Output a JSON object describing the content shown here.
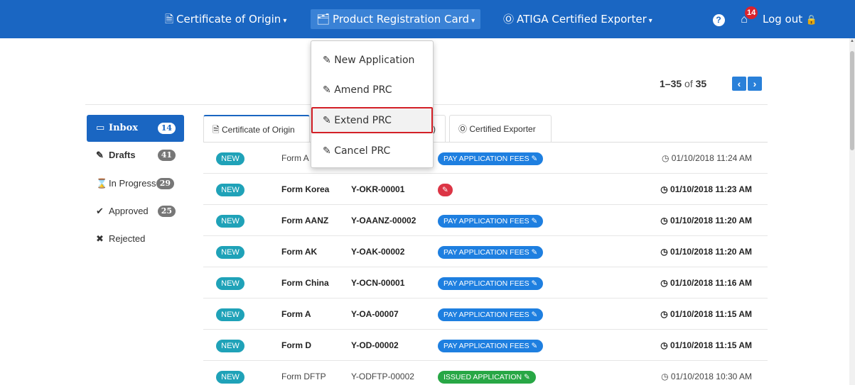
{
  "colors": {
    "navbar": "#1a66c2",
    "accent": "#2980d9",
    "badge_new": "#1fa2b8",
    "status_pay": "#1e7fe0",
    "status_issued": "#28a745",
    "status_alert": "#dc3545",
    "highlight": "#d32027"
  },
  "nav": {
    "coo": {
      "icon": "certificate-icon",
      "label": "Certificate of Origin"
    },
    "prc": {
      "icon": "card-icon",
      "label": "Product Registration Card"
    },
    "atiga": {
      "icon": "exporter-icon",
      "label": "ATIGA Certified Exporter"
    },
    "help_icon": "question-circle-icon",
    "home_icon": "home-icon",
    "notification_count": "14",
    "logout_label": "Log out",
    "logout_icon": "lock-icon"
  },
  "dropdown": {
    "items": [
      {
        "label": "New Application",
        "icon": "pencil-icon"
      },
      {
        "label": "Amend PRC",
        "icon": "pencil-icon"
      },
      {
        "label": "Extend PRC",
        "icon": "pencil-icon"
      },
      {
        "label": "Cancel PRC",
        "icon": "pencil-icon"
      }
    ]
  },
  "pagination": {
    "range": "1–35",
    "of": "of",
    "total": "35"
  },
  "sidebar": {
    "items": [
      {
        "label": "Inbox",
        "icon": "inbox-icon",
        "count": "14"
      },
      {
        "label": "Drafts",
        "icon": "edit-icon",
        "count": "41"
      },
      {
        "label": "In Progress",
        "icon": "hourglass-icon",
        "count": "29"
      },
      {
        "label": "Approved",
        "icon": "check-circle-icon",
        "count": "25"
      },
      {
        "label": "Rejected",
        "icon": "times-circle-icon",
        "count": ""
      }
    ]
  },
  "tabs": [
    {
      "label": "Certificate of Origin",
      "icon": "certificate-icon"
    },
    {
      "label": ")",
      "icon": ""
    },
    {
      "label": "Certified Exporter",
      "icon": "exporter-icon"
    }
  ],
  "rows": [
    {
      "badge": "NEW",
      "form": "Form A",
      "ref": "",
      "status": "PAY APPLICATION FEES",
      "status_type": "pay",
      "time": "01/10/2018 11:24 AM",
      "bold": false
    },
    {
      "badge": "NEW",
      "form": "Form Korea",
      "ref": "Y-OKR-00001",
      "status": "",
      "status_type": "alert",
      "time": "01/10/2018 11:23 AM",
      "bold": true
    },
    {
      "badge": "NEW",
      "form": "Form AANZ",
      "ref": "Y-OAANZ-00002",
      "status": "PAY APPLICATION FEES",
      "status_type": "pay",
      "time": "01/10/2018 11:20 AM",
      "bold": true
    },
    {
      "badge": "NEW",
      "form": "Form AK",
      "ref": "Y-OAK-00002",
      "status": "PAY APPLICATION FEES",
      "status_type": "pay",
      "time": "01/10/2018 11:20 AM",
      "bold": true
    },
    {
      "badge": "NEW",
      "form": "Form China",
      "ref": "Y-OCN-00001",
      "status": "PAY APPLICATION FEES",
      "status_type": "pay",
      "time": "01/10/2018 11:16 AM",
      "bold": true
    },
    {
      "badge": "NEW",
      "form": "Form A",
      "ref": "Y-OA-00007",
      "status": "PAY APPLICATION FEES",
      "status_type": "pay",
      "time": "01/10/2018 11:15 AM",
      "bold": true
    },
    {
      "badge": "NEW",
      "form": "Form D",
      "ref": "Y-OD-00002",
      "status": "PAY APPLICATION FEES",
      "status_type": "pay",
      "time": "01/10/2018 11:15 AM",
      "bold": true
    },
    {
      "badge": "NEW",
      "form": "Form DFTP",
      "ref": "Y-ODFTP-00002",
      "status": "ISSUED APPLICATION",
      "status_type": "issued",
      "time": "01/10/2018 10:30 AM",
      "bold": false
    }
  ]
}
